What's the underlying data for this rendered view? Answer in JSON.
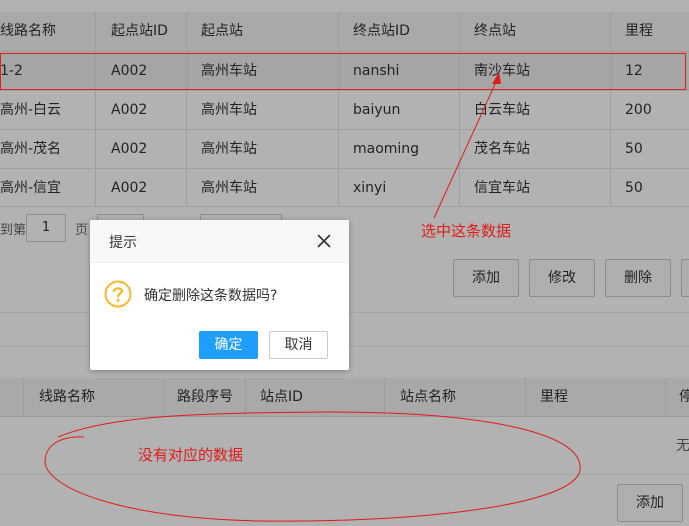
{
  "top_table": {
    "headers": [
      "线路名称",
      "起点站ID",
      "起点站",
      "终点站ID",
      "终点站",
      "里程"
    ],
    "rows": [
      [
        "1-2",
        "A002",
        "高州车站",
        "nanshi",
        "南沙车站",
        "12"
      ],
      [
        "高州-白云",
        "A002",
        "高州车站",
        "baiyun",
        "白云车站",
        "200"
      ],
      [
        "高州-茂名",
        "A002",
        "高州车站",
        "maoming",
        "茂名车站",
        "50"
      ],
      [
        "高州-信宜",
        "A002",
        "高州车站",
        "xinyi",
        "信宜车站",
        "50"
      ]
    ]
  },
  "pager": {
    "prefix": "到第",
    "page_value": "1",
    "suffix": "页"
  },
  "toolbar": {
    "add_label": "添加",
    "edit_label": "修改",
    "delete_label": "删除"
  },
  "bottom_table": {
    "headers": [
      "线路名称",
      "路段序号",
      "站点ID",
      "站点名称",
      "里程",
      "停"
    ],
    "empty_text": "无",
    "add_label": "添加"
  },
  "annotations": {
    "selected_note": "选中这条数据",
    "empty_note": "没有对应的数据"
  },
  "dialog": {
    "title": "提示",
    "message": "确定删除这条数据吗?",
    "ok_label": "确定",
    "cancel_label": "取消",
    "icon": "question-icon",
    "close_icon": "close-icon"
  },
  "colors": {
    "primary": "#1e9fff",
    "annotation": "#e01b1b",
    "warning_icon": "#f7b824"
  }
}
